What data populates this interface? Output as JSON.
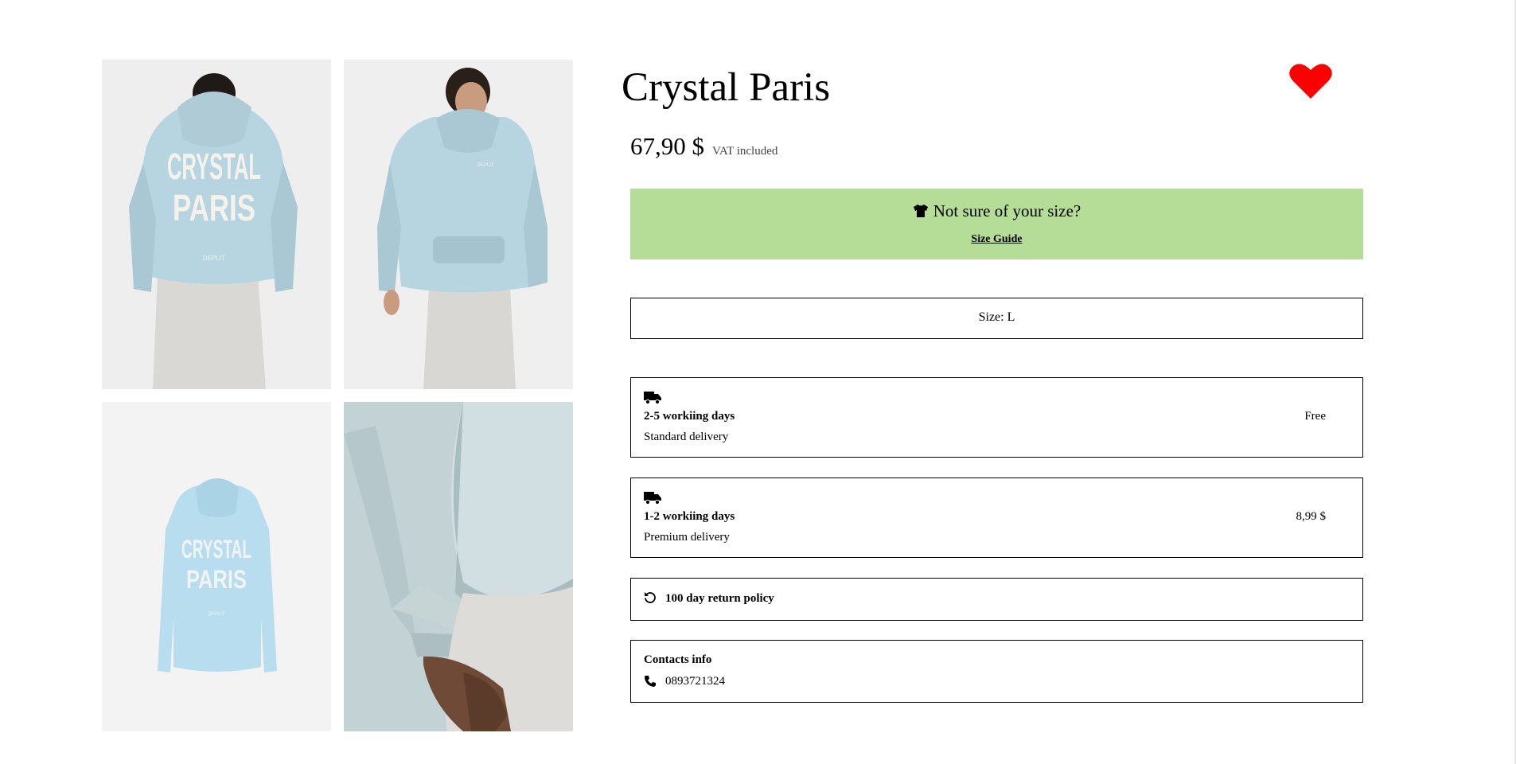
{
  "product": {
    "title": "Crystal Paris",
    "price": "67,90 $",
    "vat_note": "VAT included"
  },
  "favorite": {
    "icon": "heart-icon",
    "color": "#ff0000"
  },
  "gallery": {
    "images": [
      {
        "id": "back-view-model",
        "print_lines": [
          "CRYSTAL",
          "PARIS"
        ],
        "print_small": "DEPLIT"
      },
      {
        "id": "front-view-model",
        "print_small": "DEPLIT"
      },
      {
        "id": "flat-back-view",
        "print_lines": [
          "CRYSTAL",
          "PARIS"
        ],
        "print_small": "DEPLIT"
      },
      {
        "id": "sleeve-detail"
      }
    ],
    "hoodie_color": "#b7d5e0"
  },
  "size_banner": {
    "background": "#b5dd97",
    "icon": "tshirt-icon",
    "question": "Not sure of your size?",
    "link": "Size Guide"
  },
  "size_select": {
    "label": "Size: L"
  },
  "delivery": [
    {
      "icon": "truck-icon",
      "days": "2-5 workiing days",
      "name": "Standard delivery",
      "price": "Free"
    },
    {
      "icon": "truck-icon",
      "days": "1-2 workiing days",
      "name": "Premium delivery",
      "price": "8,99 $"
    }
  ],
  "returns": {
    "icon": "undo-icon",
    "label": "100 day return policy"
  },
  "contacts": {
    "heading": "Contacts info",
    "icon": "phone-icon",
    "phone": "0893721324"
  }
}
